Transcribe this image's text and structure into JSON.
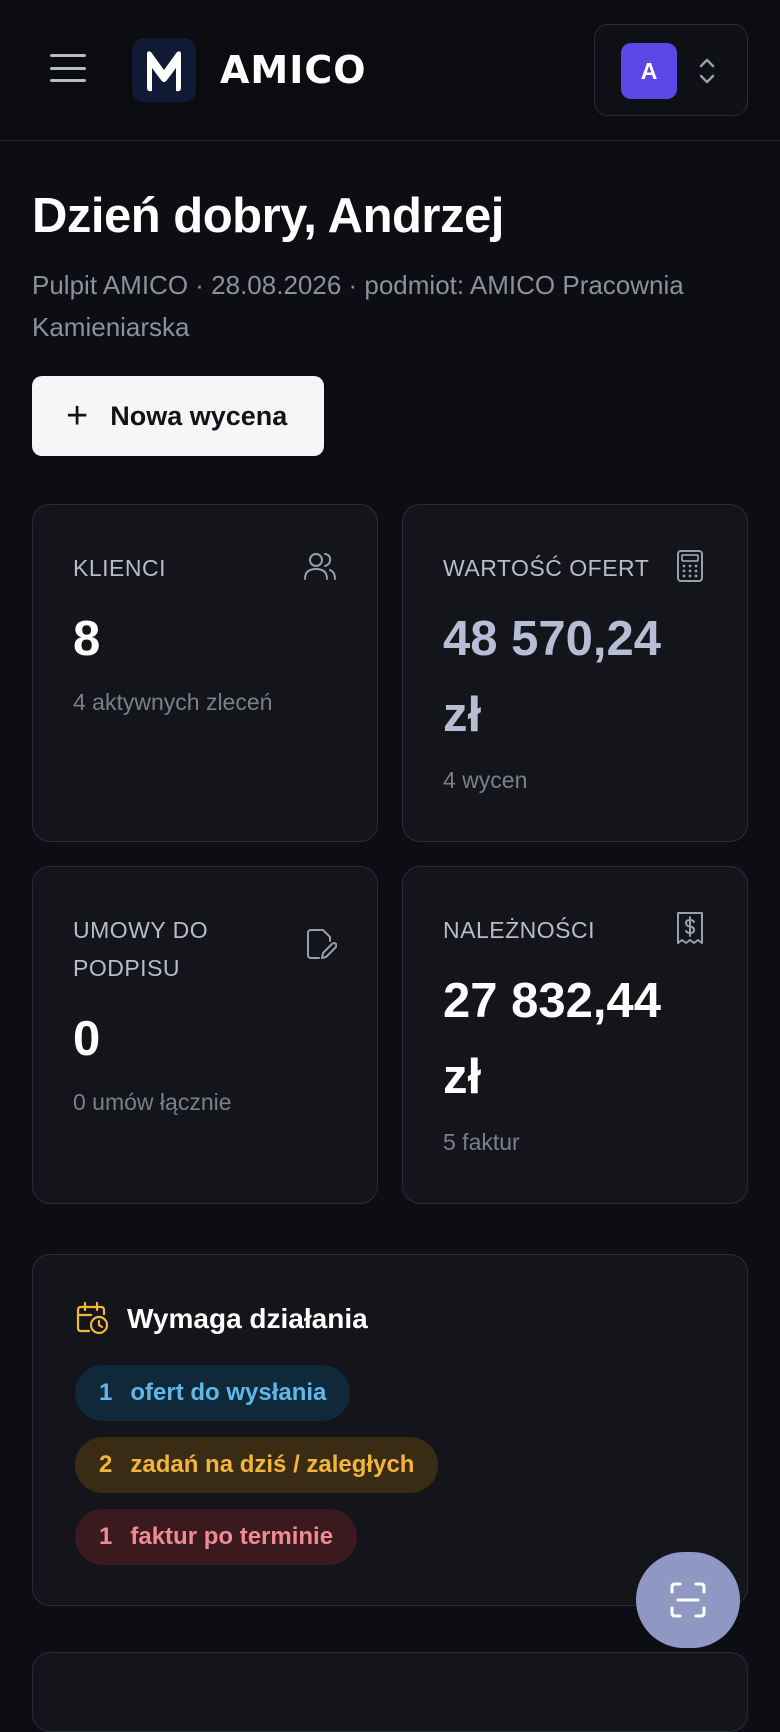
{
  "header": {
    "brand": "AMICO",
    "avatar_initial": "A"
  },
  "dashboard": {
    "greeting": "Dzień dobry, Andrzej",
    "subtitle": "Pulpit AMICO · 28.08.2026 · podmiot: AMICO Pracownia Kamieniarska",
    "new_quote_label": "Nowa wycena"
  },
  "cards": {
    "clients": {
      "label": "KLIENCI",
      "value": "8",
      "sub": "4 aktywnych zleceń",
      "icon": "users-icon"
    },
    "offers": {
      "label": "WARTOŚĆ OFERT",
      "value_line1": "48 570,24",
      "value_line2": "zł",
      "sub": "4 wycen",
      "icon": "calculator-icon"
    },
    "contracts": {
      "label": "UMOWY DO PODPISU",
      "value": "0",
      "sub": "0 umów łącznie",
      "icon": "document-edit-icon"
    },
    "receivables": {
      "label": "NALEŻNOŚCI",
      "value_line1": "27 832,44",
      "value_line2": "zł",
      "sub": "5 faktur",
      "icon": "receipt-dollar-icon"
    }
  },
  "action_required": {
    "title": "Wymaga działania",
    "icon": "calendar-clock-icon",
    "items": [
      {
        "count": "1",
        "label": "ofert do wysłania",
        "color": "#5eb8e8"
      },
      {
        "count": "2",
        "label": "zadań na dziś / zaległych",
        "color": "#f2b63a"
      },
      {
        "count": "1",
        "label": "faktur po terminie",
        "color": "#f08a94"
      }
    ]
  },
  "colors": {
    "background": "#0d0e13",
    "card": "#14151b",
    "accent_avatar": "#5b47e6",
    "fab": "#8e98c2"
  }
}
